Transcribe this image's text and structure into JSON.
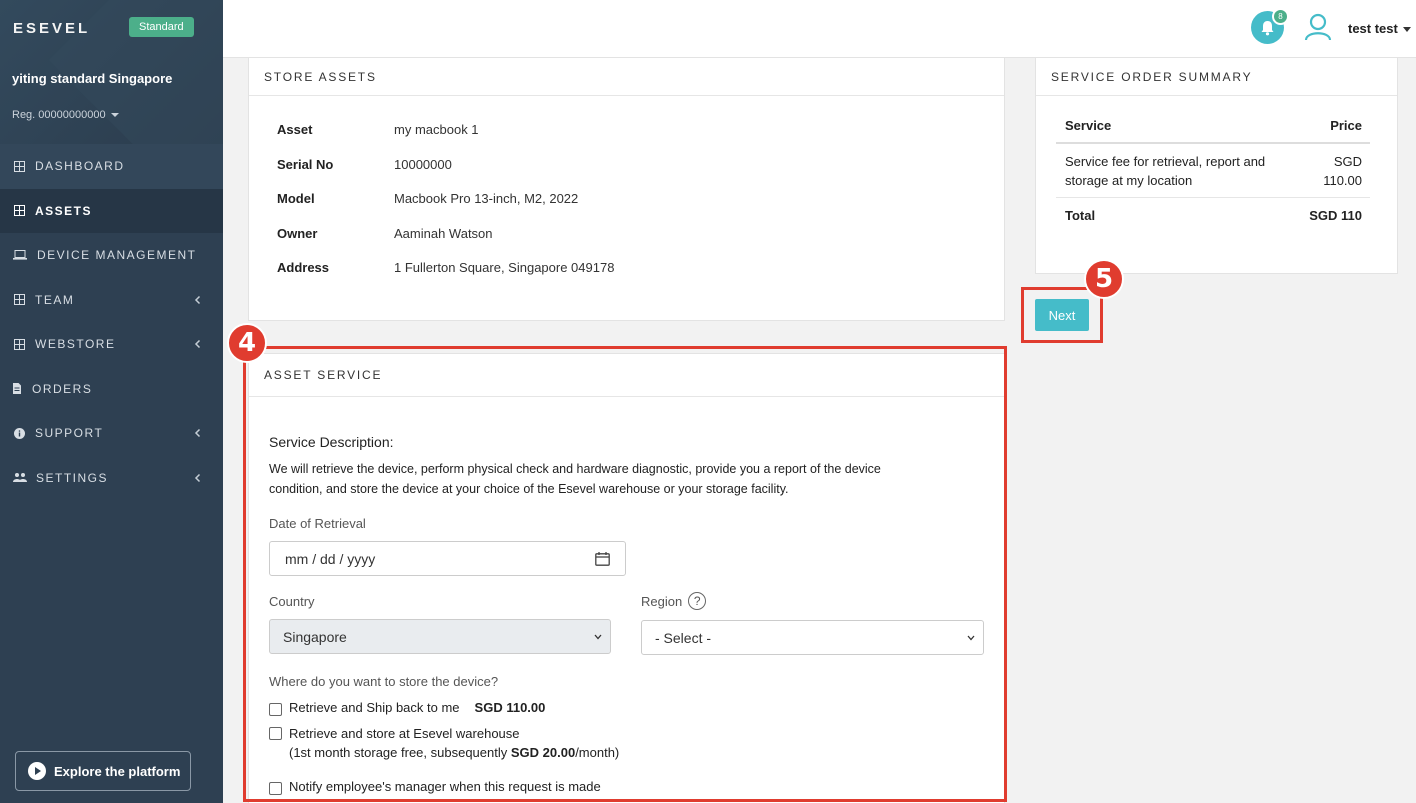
{
  "sidebar": {
    "brand": "ESEVEL",
    "plan_badge": "Standard",
    "org_name": "yiting standard Singapore",
    "org_reg": "Reg. 00000000000",
    "nav": [
      {
        "label": "DASHBOARD",
        "icon": "grid-icon",
        "chevron": false
      },
      {
        "label": "ASSETS",
        "icon": "grid-icon",
        "chevron": false,
        "active": true
      },
      {
        "label": "DEVICE MANAGEMENT",
        "icon": "laptop-icon",
        "chevron": false
      },
      {
        "label": "TEAM",
        "icon": "grid-icon",
        "chevron": true
      },
      {
        "label": "WEBSTORE",
        "icon": "grid-icon",
        "chevron": true
      },
      {
        "label": "ORDERS",
        "icon": "document-icon",
        "chevron": false
      },
      {
        "label": "SUPPORT",
        "icon": "info-icon",
        "chevron": true
      },
      {
        "label": "SETTINGS",
        "icon": "users-icon",
        "chevron": true
      }
    ],
    "explore_label": "Explore the platform"
  },
  "topbar": {
    "notification_count": "8",
    "user_name": "test test"
  },
  "store_assets": {
    "title": "STORE ASSETS",
    "rows": [
      {
        "key": "Asset",
        "value": "my macbook 1"
      },
      {
        "key": "Serial No",
        "value": "10000000"
      },
      {
        "key": "Model",
        "value": "Macbook Pro 13-inch, M2, 2022"
      },
      {
        "key": "Owner",
        "value": "Aaminah Watson"
      },
      {
        "key": "Address",
        "value": "1 Fullerton Square, Singapore 049178"
      }
    ]
  },
  "summary": {
    "title": "SERVICE ORDER SUMMARY",
    "col_service": "Service",
    "col_price": "Price",
    "item_service": "Service fee for retrieval, report and storage at my location",
    "item_price_currency": "SGD",
    "item_price_amount": "110.00",
    "total_label": "Total",
    "total_value": "SGD 110"
  },
  "next_label": "Next",
  "step_markers": {
    "service": "4",
    "next": "5"
  },
  "asset_service": {
    "title": "ASSET SERVICE",
    "desc_title": "Service Description:",
    "desc_line1": "We will retrieve the device, perform physical check and hardware diagnostic, provide you a report of the device",
    "desc_line2": "condition, and store the device at your choice of the Esevel warehouse or your storage facility.",
    "date_label": "Date of Retrieval",
    "date_placeholder": "mm / dd / yyyy",
    "country_label": "Country",
    "country_value": "Singapore",
    "region_label": "Region",
    "region_help": "?",
    "region_value": "- Select -",
    "store_question": "Where do you want to store the device?",
    "opt1_label": "Retrieve and Ship back to me",
    "opt1_price": "SGD 110.00",
    "opt2_label": "Retrieve and store at Esevel warehouse",
    "opt2_sub_pre": "(1st month storage free, subsequently ",
    "opt2_sub_price": "SGD 20.00",
    "opt2_sub_post": "/month)",
    "notify_label": "Notify employee's manager when this request is made"
  },
  "colors": {
    "sidebar_bg": "#2e4052",
    "accent_teal": "#45bcc9",
    "badge_green": "#4caf8a",
    "highlight_red": "#e03c2f"
  }
}
